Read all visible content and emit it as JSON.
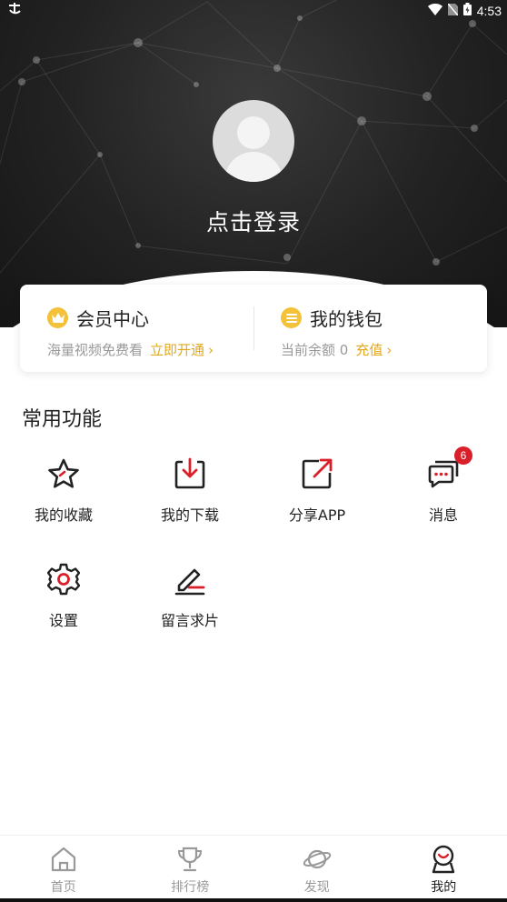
{
  "status_bar": {
    "time": "4:53"
  },
  "profile": {
    "login_text": "点击登录"
  },
  "membership": {
    "vip": {
      "title": "会员中心",
      "subtitle": "海量视频免费看",
      "action": "立即开通"
    },
    "wallet": {
      "title": "我的钱包",
      "subtitle": "当前余额 0",
      "action": "充值"
    }
  },
  "functions": {
    "title": "常用功能",
    "items": [
      {
        "label": "我的收藏",
        "icon": "star-icon"
      },
      {
        "label": "我的下载",
        "icon": "download-icon"
      },
      {
        "label": "分享APP",
        "icon": "share-icon"
      },
      {
        "label": "消息",
        "icon": "message-icon",
        "badge": "6"
      },
      {
        "label": "设置",
        "icon": "gear-icon"
      },
      {
        "label": "留言求片",
        "icon": "edit-icon"
      }
    ]
  },
  "bottom_nav": {
    "items": [
      {
        "label": "首页",
        "icon": "home-icon"
      },
      {
        "label": "排行榜",
        "icon": "trophy-icon"
      },
      {
        "label": "发现",
        "icon": "planet-icon"
      },
      {
        "label": "我的",
        "icon": "profile-icon",
        "active": true
      }
    ]
  },
  "colors": {
    "accent": "#e3a81b",
    "badge": "#d91f2a",
    "icon_red": "#d91f2a",
    "header": "#222222"
  }
}
